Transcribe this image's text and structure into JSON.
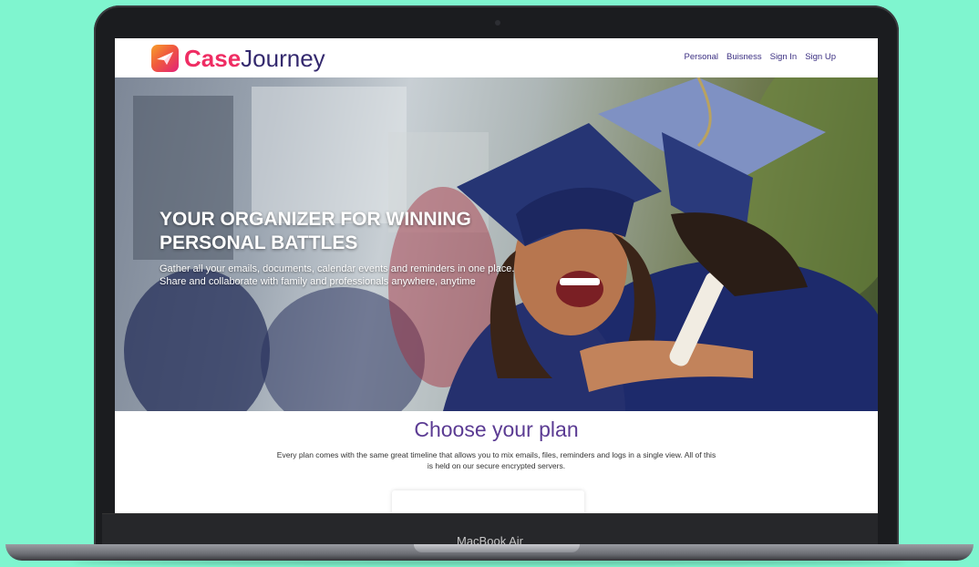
{
  "device": {
    "label": "MacBook Air"
  },
  "header": {
    "logo_case": "Case",
    "logo_journey": "Journey",
    "nav": [
      "Personal",
      "Buisness",
      "Sign In",
      "Sign Up"
    ]
  },
  "hero": {
    "title": "YOUR ORGANIZER FOR WINNING PERSONAL BATTLES",
    "subtitle": "Gather all your emails, documents, calendar events and reminders in one place. Share and collaborate with family and professionals anywhere, anytime"
  },
  "plans": {
    "title": "Choose your plan",
    "description": "Every plan comes with the same great timeline that allows you to mix emails, files, reminders and logs in a single view. All of this is held on our secure encrypted servers."
  },
  "colors": {
    "background": "#7ff5cf",
    "brand_pink": "#ef2d63",
    "brand_navy": "#34296e",
    "heading_purple": "#5b3b93"
  }
}
